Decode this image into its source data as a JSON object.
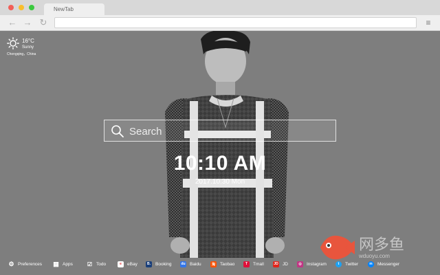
{
  "browser": {
    "tab_title": "NewTab",
    "back_icon": "←",
    "forward_icon": "→",
    "reload_icon": "↻",
    "menu_icon": "≡",
    "address": ""
  },
  "weather": {
    "temperature": "16°C",
    "condition": "Sunny",
    "location": "Chongqing，China"
  },
  "search": {
    "placeholder": "Search"
  },
  "clock": {
    "time": "10:10 AM",
    "date": "2017.10.30 Mon"
  },
  "watermark": {
    "text": "网多鱼",
    "url": "wduoyu.com",
    "color": "#e8553d"
  },
  "bottom_links": [
    {
      "label": "Preferences",
      "icon": "gear-icon"
    },
    {
      "label": "Apps",
      "icon": "grid-icon"
    },
    {
      "label": "Todo",
      "icon": "checkbox-icon"
    },
    {
      "label": "eBay",
      "icon": "ebay-icon"
    },
    {
      "label": "Booking",
      "icon": "booking-icon",
      "color": "#1a3f7a"
    },
    {
      "label": "Baidu",
      "icon": "baidu-icon",
      "color": "#3476e8"
    },
    {
      "label": "Taobao",
      "icon": "taobao-icon",
      "color": "#ff5000"
    },
    {
      "label": "Tmall",
      "icon": "tmall-icon",
      "color": "#e0103a"
    },
    {
      "label": "JD",
      "icon": "jd-icon",
      "color": "#e1251b"
    },
    {
      "label": "Instagram",
      "icon": "instagram-icon",
      "color": "#c13584"
    },
    {
      "label": "Twitter",
      "icon": "twitter-icon",
      "color": "#1da1f2"
    },
    {
      "label": "Messenger",
      "icon": "messenger-icon",
      "color": "#0084ff"
    }
  ]
}
